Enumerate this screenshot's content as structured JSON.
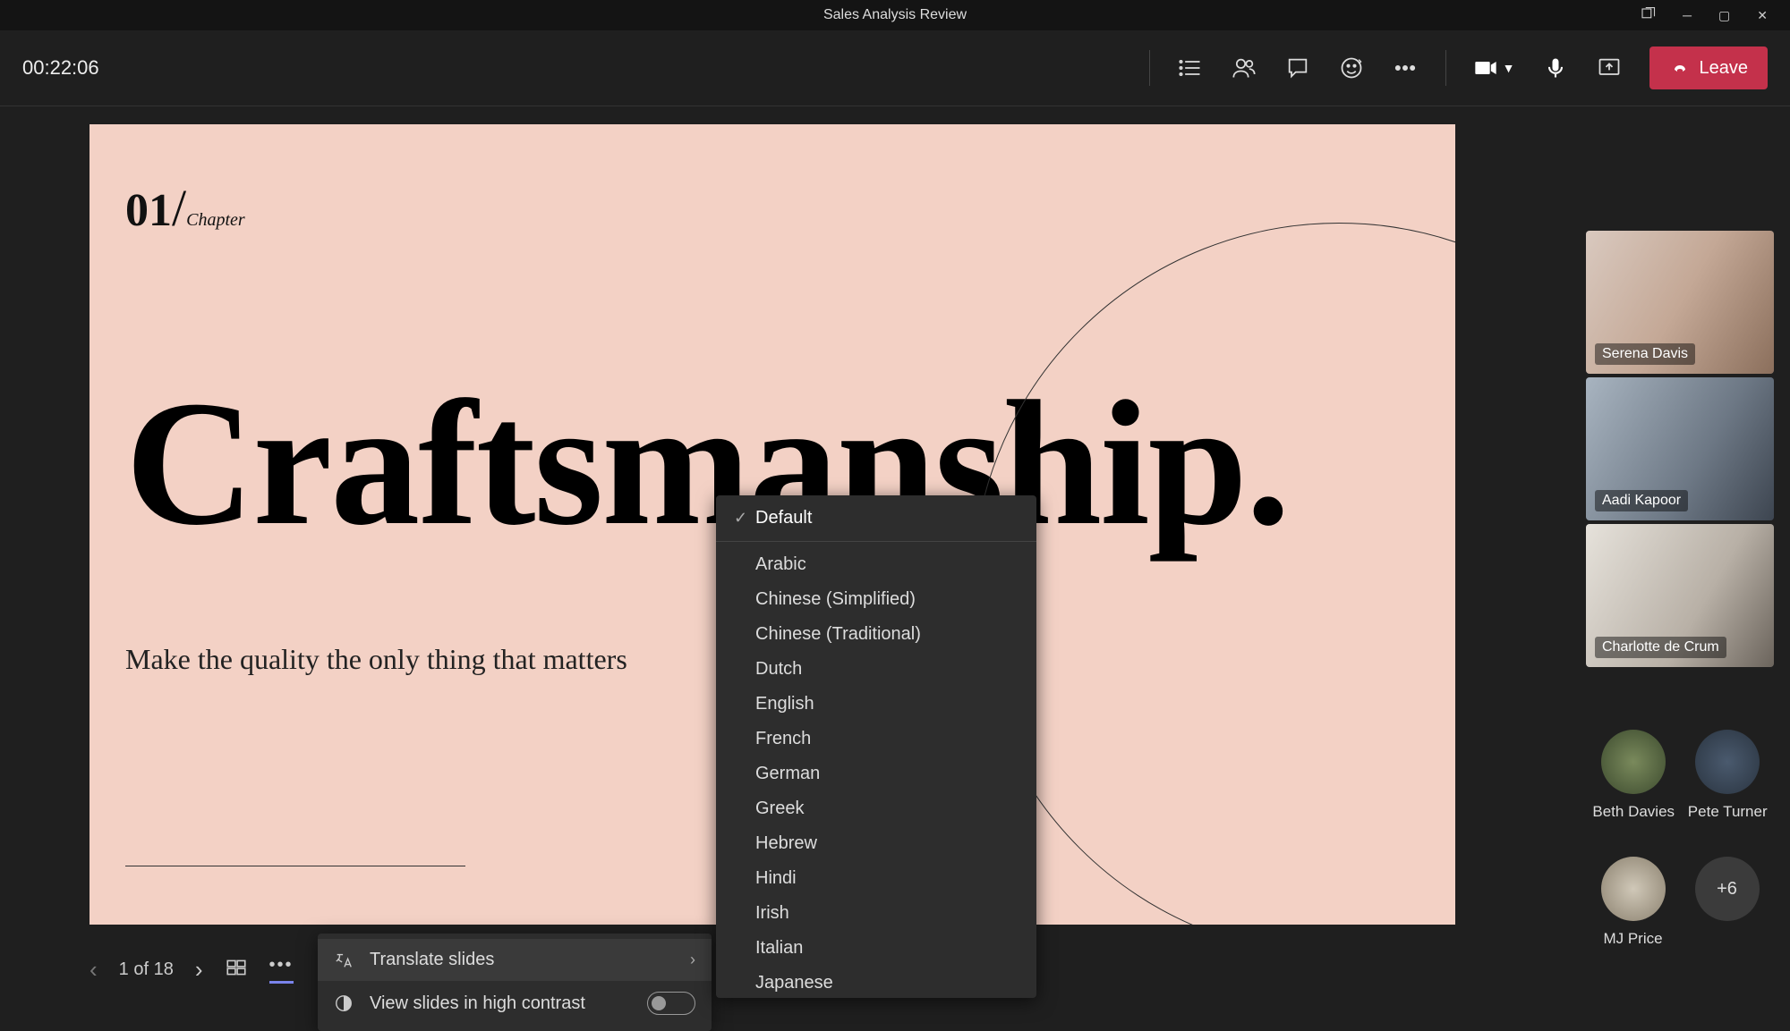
{
  "window": {
    "title": "Sales Analysis Review"
  },
  "meeting": {
    "duration": "00:22:06",
    "leave_label": "Leave"
  },
  "slide": {
    "chapter_number": "01",
    "chapter_slash": "/",
    "chapter_label": "Chapter",
    "title": "Craftsmanship.",
    "subtitle": "Make the quality the only thing that matters"
  },
  "slide_menu": {
    "translate_label": "Translate slides",
    "contrast_label": "View slides in high contrast"
  },
  "language_menu": {
    "default_label": "Default",
    "languages": [
      "Arabic",
      "Chinese (Simplified)",
      "Chinese (Traditional)",
      "Dutch",
      "English",
      "French",
      "German",
      "Greek",
      "Hebrew",
      "Hindi",
      "Irish",
      "Italian",
      "Japanese"
    ]
  },
  "nav": {
    "page_label": "1 of 18"
  },
  "participants": {
    "video": [
      {
        "name": "Serena Davis"
      },
      {
        "name": "Aadi Kapoor"
      },
      {
        "name": "Charlotte de Crum"
      }
    ],
    "audio": [
      {
        "name": "Beth Davies"
      },
      {
        "name": "Pete Turner"
      },
      {
        "name": "MJ Price"
      }
    ],
    "overflow_label": "+6"
  }
}
